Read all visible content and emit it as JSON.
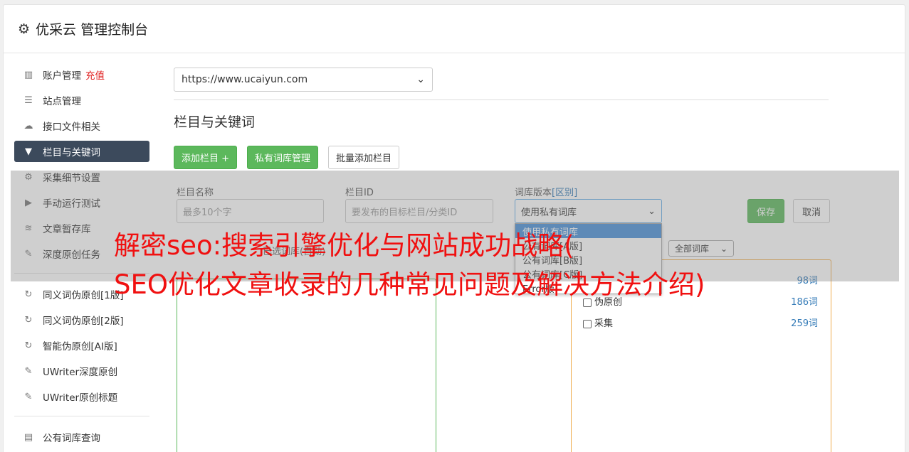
{
  "header": {
    "title": "优采云 管理控制台"
  },
  "sidebar": {
    "items": [
      {
        "label": "账户管理",
        "icon": "bar-chart-icon"
      },
      {
        "label": "站点管理",
        "icon": "server-icon"
      },
      {
        "label": "接口文件相关",
        "icon": "cloud-upload-icon"
      },
      {
        "label": "栏目与关键词",
        "icon": "filter-icon"
      },
      {
        "label": "采集细节设置",
        "icon": "gears-icon"
      },
      {
        "label": "手动运行测试",
        "icon": "play-icon"
      },
      {
        "label": "文章暂存库",
        "icon": "database-icon"
      },
      {
        "label": "深度原创任务",
        "icon": "edit-icon"
      }
    ],
    "recharge": "充值",
    "items2": [
      {
        "label": "同义词伪原创[1版]",
        "icon": "refresh-icon"
      },
      {
        "label": "同义词伪原创[2版]",
        "icon": "refresh-icon"
      },
      {
        "label": "智能伪原创[AI版]",
        "icon": "refresh-icon"
      },
      {
        "label": "UWriter深度原创",
        "icon": "edit-icon"
      },
      {
        "label": "UWriter原创标题",
        "icon": "edit-icon"
      }
    ],
    "items3": [
      {
        "label": "公有词库查询",
        "icon": "book-icon"
      }
    ]
  },
  "main": {
    "site_select": "https://www.ucaiyun.com",
    "section_title": "栏目与关键词",
    "buttons": {
      "add_column": "添加栏目 +",
      "private_lib": "私有词库管理",
      "batch_add": "批量添加栏目"
    },
    "form": {
      "name_label": "栏目名称",
      "name_placeholder": "最多10个字",
      "id_label": "栏目ID",
      "id_placeholder": "要发布的目标栏目/分类ID",
      "version_label": "词库版本",
      "version_label_link": "[区别]",
      "version_value": "使用私有词库",
      "save": "保存",
      "cancel": "取消"
    },
    "dropdown_options": [
      "使用私有词库",
      "公有词库[A版]",
      "公有词库[B版]",
      "公有词库[C版]",
      "Error版"
    ],
    "left_panel_title": "已选词库(自动)",
    "lib_filter": "全部词库",
    "libs": [
      {
        "name": "",
        "count": "98词"
      },
      {
        "name": "伪原创",
        "count": "186词"
      },
      {
        "name": "采集",
        "count": "259词"
      }
    ]
  },
  "overlay": {
    "line1": "解密seo:搜索引擎优化与网站成功战略(",
    "line2": "SEO优化文章收录的几种常见问题及解决方法介绍)"
  }
}
